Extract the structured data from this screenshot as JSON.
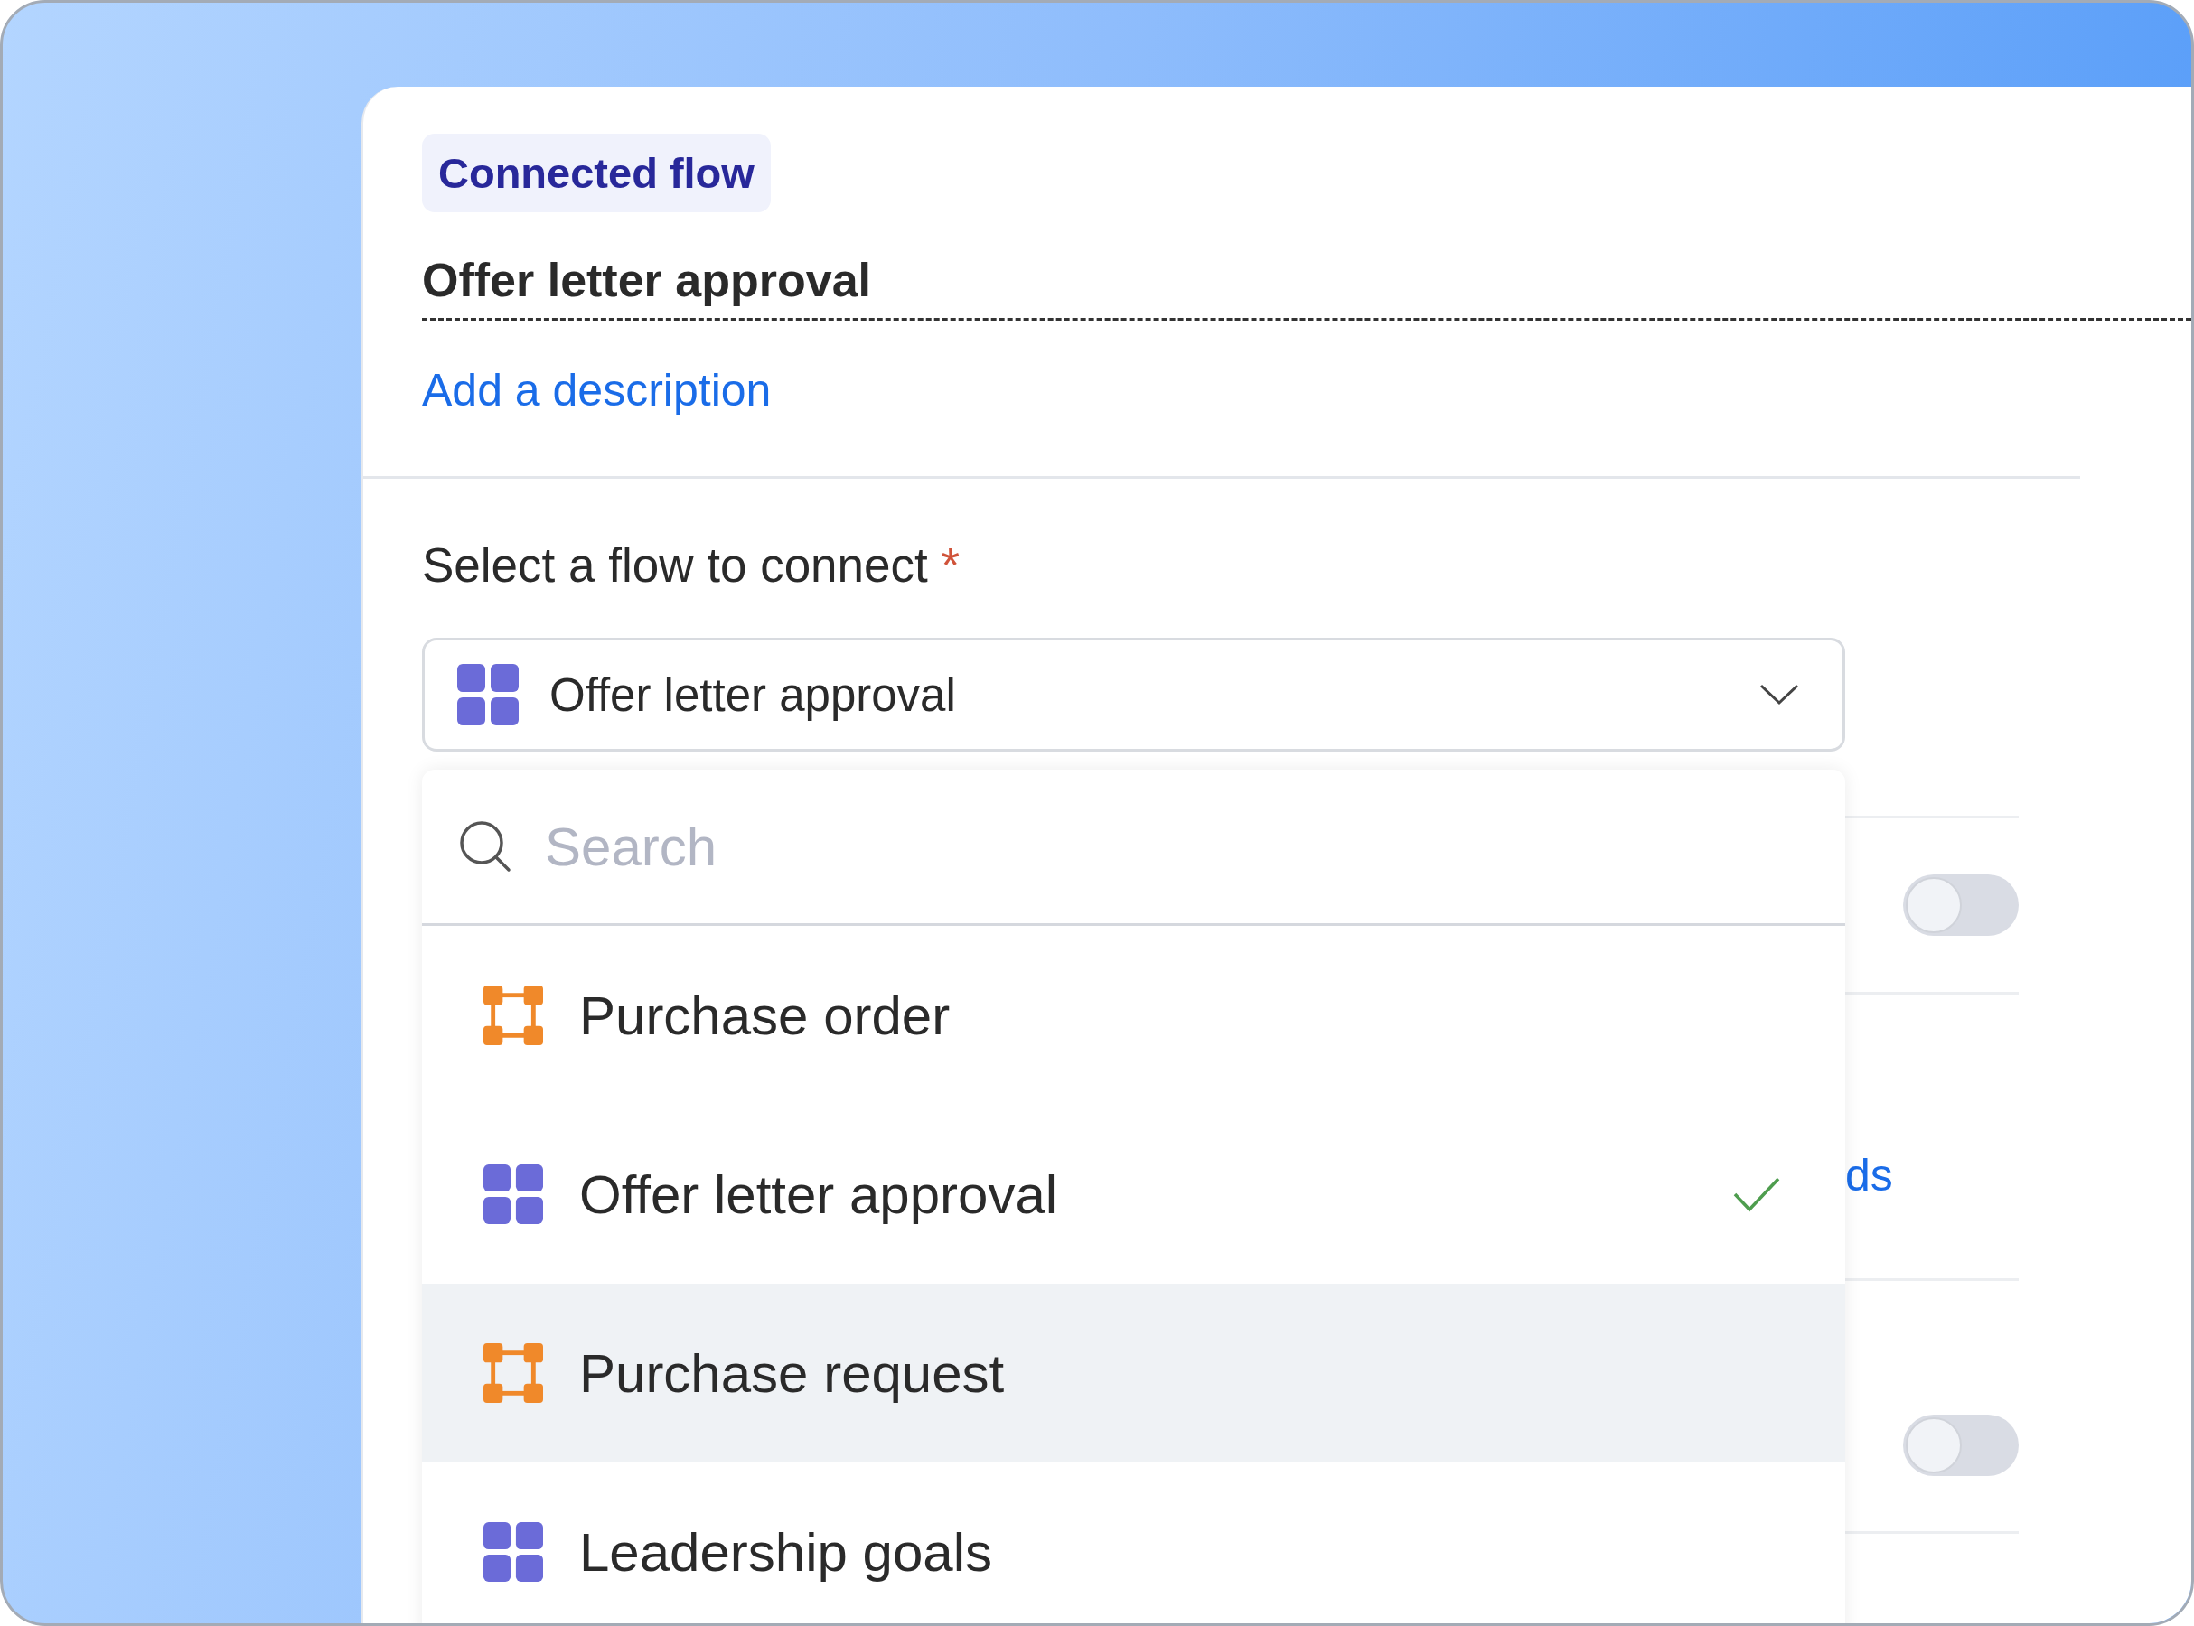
{
  "badge": "Connected flow",
  "title": "Offer letter approval",
  "description_link": "Add a description",
  "field": {
    "label": "Select a flow to connect",
    "required_mark": "*",
    "value": "Offer letter approval",
    "kind": "grid"
  },
  "dropdown": {
    "search": {
      "placeholder": "Search"
    },
    "options": [
      {
        "label": "Purchase order",
        "kind": "nodes",
        "selected": false,
        "highlighted": false
      },
      {
        "label": "Offer letter approval",
        "kind": "grid",
        "selected": true,
        "highlighted": false
      },
      {
        "label": "Purchase request",
        "kind": "nodes",
        "selected": false,
        "highlighted": true
      },
      {
        "label": "Leadership goals",
        "kind": "grid",
        "selected": false,
        "highlighted": false
      }
    ]
  },
  "background_rows": [
    {
      "kind": "toggle",
      "on": false
    },
    {
      "kind": "link",
      "text": "ds"
    },
    {
      "kind": "toggle",
      "on": false
    }
  ]
}
